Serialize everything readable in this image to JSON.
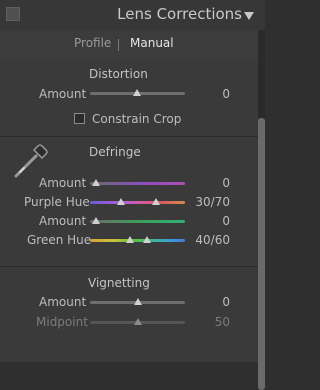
{
  "header": {
    "title": "Lens Corrections"
  },
  "tabs": {
    "profile": "Profile",
    "manual": "Manual"
  },
  "distortion": {
    "title": "Distortion",
    "amount_label": "Amount",
    "amount_value": "0",
    "constrain_crop_label": "Constrain Crop",
    "constrain_crop_checked": false
  },
  "defringe": {
    "title": "Defringe",
    "purple_amount_label": "Amount",
    "purple_amount_value": "0",
    "purple_hue_label": "Purple Hue",
    "purple_hue_value": "30/70",
    "green_amount_label": "Amount",
    "green_amount_value": "0",
    "green_hue_label": "Green Hue",
    "green_hue_value": "40/60"
  },
  "vignetting": {
    "title": "Vignetting",
    "amount_label": "Amount",
    "amount_value": "0",
    "midpoint_label": "Midpoint",
    "midpoint_value": "50"
  },
  "colors": {
    "panel_bg": "#3a3a3a",
    "text": "#bdbdbd",
    "dim_text": "#7b7b7b",
    "accent_white": "#e6e6e6"
  },
  "icons": {
    "collapse": "triangle-down-icon",
    "eyedropper": "eyedropper-icon"
  }
}
